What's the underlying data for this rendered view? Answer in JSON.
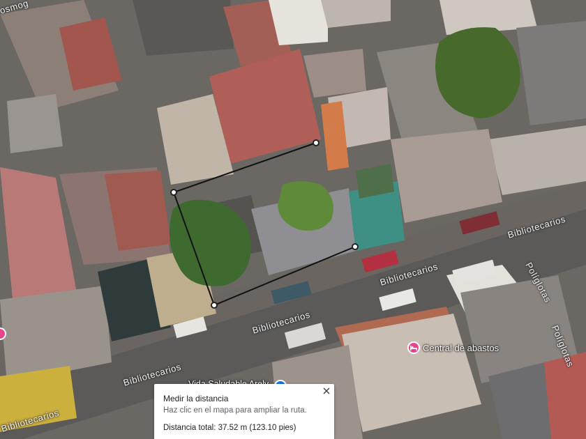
{
  "map": {
    "view": "satellite",
    "colors": {
      "roof_red": "#a55a52",
      "roof_grey": "#8a8580",
      "street": "#5d5c5b",
      "tree": "#4e6e30",
      "teal_roof": "#3e8f84",
      "poi_pink": "#e8458b",
      "route_line": "#000000"
    },
    "streets": [
      {
        "name": "Bibliotecarios"
      },
      {
        "name": "Bibliotecarios"
      },
      {
        "name": "Bibliotecarios"
      },
      {
        "name": "Bibliotecarios"
      },
      {
        "name": "Bibliotecarios"
      },
      {
        "name": "Políglotas"
      },
      {
        "name": "Políglotas"
      },
      {
        "name": "osmog"
      }
    ],
    "pois": [
      {
        "name": "Central de abastos",
        "icon": "hotel-bed-icon",
        "color": "#e8458b"
      },
      {
        "name": "Vida Saludable Arely",
        "icon": "shop-icon",
        "color": "#1a73e8"
      }
    ]
  },
  "measure_panel": {
    "title": "Medir la distancia",
    "hint": "Haz clic en el mapa para ampliar la ruta.",
    "total": "Distancia total: 37.52 m (123.10 pies)",
    "close_icon": "close-icon"
  }
}
